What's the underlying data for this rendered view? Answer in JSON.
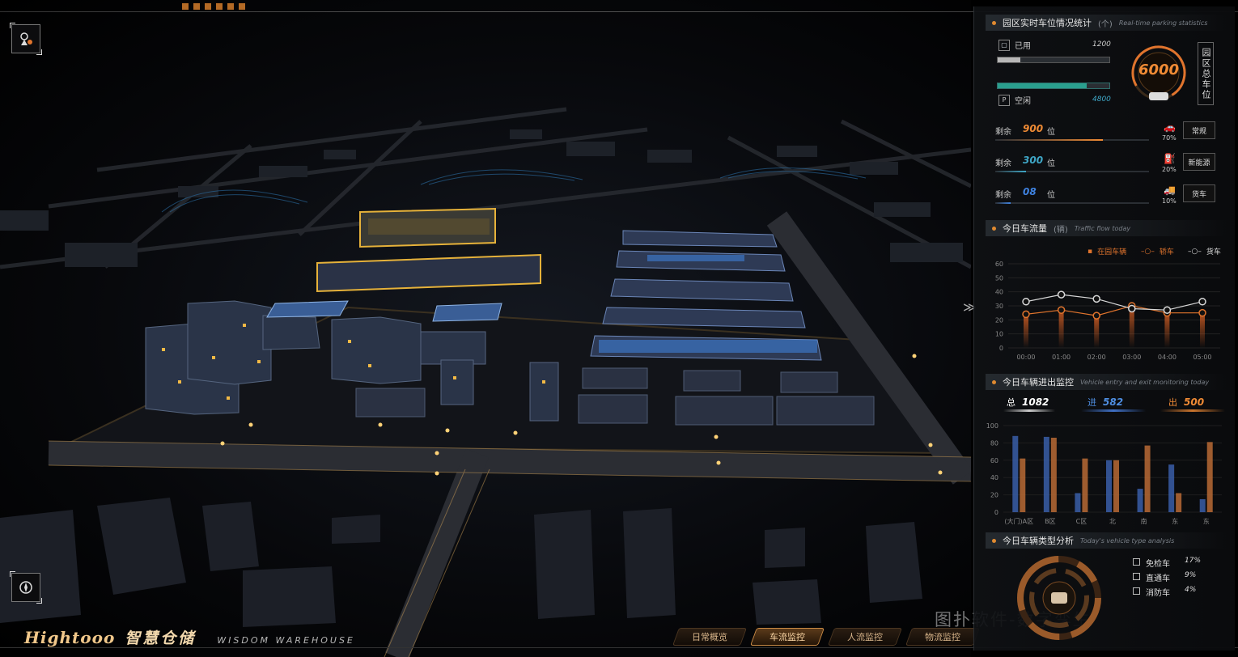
{
  "header": {
    "colors": {
      "accent": "#e0842d"
    }
  },
  "brand": {
    "en": "Hightooo",
    "cn": "智慧仓储",
    "sub": "WISDOM WAREHOUSE"
  },
  "nav_tabs": [
    {
      "label": "日常概览"
    },
    {
      "label": "车流监控",
      "active": true
    },
    {
      "label": "人流监控"
    },
    {
      "label": "物流监控"
    }
  ],
  "watermark": "图扑软件-数字孪生",
  "icons": {
    "top_left": "map-marker-icon",
    "bottom_left": "compass-icon",
    "side_arrow": "chevron-right-icon"
  },
  "parking": {
    "title_cn": "园区实时车位情况统计",
    "title_unit": "(个)",
    "title_en": "Real-time parking statistics",
    "used_label": "已用",
    "used_value": "1200",
    "free_label": "空闲",
    "free_value": "4800",
    "used_pct": 0.2,
    "free_pct": 0.8,
    "total_value": "6000",
    "total_label": "园区总车位",
    "rows": [
      {
        "prefix": "剩余",
        "value": "900",
        "unit": "位",
        "pct": "70%",
        "button": "常规",
        "color": "#ee8a34",
        "fill": 0.7,
        "icon": "car-icon"
      },
      {
        "prefix": "剩余",
        "value": "300",
        "unit": "位",
        "pct": "20%",
        "button": "新能源",
        "color": "#3fa7c7",
        "fill": 0.2,
        "icon": "fuel-icon"
      },
      {
        "prefix": "剩余",
        "value": "08",
        "unit": "位",
        "pct": "10%",
        "button": "货车",
        "color": "#3f82e0",
        "fill": 0.1,
        "icon": "truck-icon"
      }
    ]
  },
  "traffic": {
    "title_cn": "今日车流量",
    "title_unit": "(辆)",
    "title_en": "Traffic flow today",
    "legend": [
      "在园车辆",
      "轿车",
      "货车"
    ]
  },
  "entry": {
    "title_cn": "今日车辆进出监控",
    "title_en": "Vehicle entry and exit monitoring today",
    "total_label": "总",
    "total_value": "1082",
    "in_label": "进",
    "in_value": "582",
    "out_label": "出",
    "out_value": "500"
  },
  "types": {
    "title_cn": "今日车辆类型分析",
    "title_en": "Today's vehicle type analysis",
    "items": [
      {
        "name": "免检车",
        "pct": "17%"
      },
      {
        "name": "直通车",
        "pct": "9%"
      },
      {
        "name": "消防车",
        "pct": "4%"
      }
    ]
  },
  "chart_data": [
    {
      "type": "line",
      "title": "今日车流量",
      "x": [
        "00:00",
        "01:00",
        "02:00",
        "03:00",
        "04:00",
        "05:00"
      ],
      "ylim": [
        0,
        60
      ],
      "yticks": [
        0,
        10,
        20,
        30,
        40,
        50,
        60
      ],
      "series": [
        {
          "name": "轿车",
          "values": [
            24,
            27,
            23,
            30,
            25,
            25
          ],
          "color": "#e0742d"
        },
        {
          "name": "货车",
          "values": [
            33,
            38,
            35,
            28,
            27,
            33
          ],
          "color": "#d8d8d8"
        }
      ],
      "grid": true,
      "legend": "top-right"
    },
    {
      "type": "bar",
      "title": "今日车辆进出监控",
      "categories": [
        "(大门)A区",
        "B区",
        "C区",
        "北",
        "南",
        "东",
        "东"
      ],
      "ylim": [
        0,
        100
      ],
      "yticks": [
        0,
        20,
        40,
        60,
        80,
        100
      ],
      "series": [
        {
          "name": "进",
          "values": [
            88,
            87,
            22,
            60,
            27,
            55,
            15
          ],
          "color": "#3a5ea8"
        },
        {
          "name": "出",
          "values": [
            62,
            86,
            62,
            60,
            77,
            22,
            81
          ],
          "color": "#b86a35"
        }
      ]
    }
  ]
}
